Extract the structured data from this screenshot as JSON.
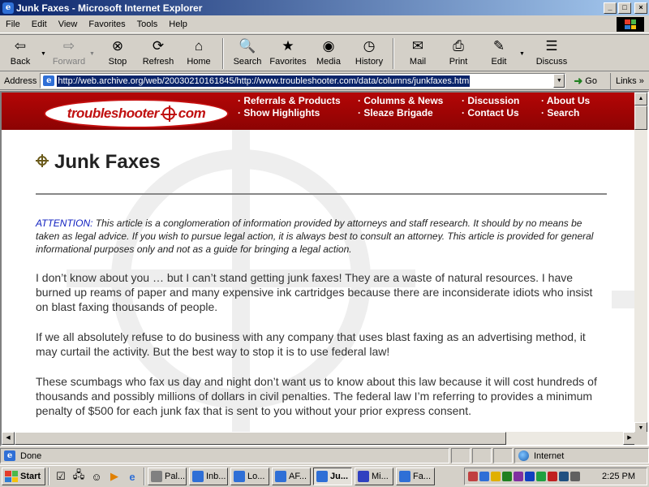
{
  "window": {
    "title": "Junk Faxes - Microsoft Internet Explorer",
    "buttons": {
      "minimize": "_",
      "maximize": "□",
      "close": "×"
    }
  },
  "menu": [
    {
      "label": "File",
      "key": "F"
    },
    {
      "label": "Edit",
      "key": "E"
    },
    {
      "label": "View",
      "key": "V"
    },
    {
      "label": "Favorites",
      "key": "a"
    },
    {
      "label": "Tools",
      "key": "T"
    },
    {
      "label": "Help",
      "key": "H"
    }
  ],
  "toolbar": {
    "back": "Back",
    "forward": "Forward",
    "stop": "Stop",
    "refresh": "Refresh",
    "home": "Home",
    "search": "Search",
    "favorites": "Favorites",
    "media": "Media",
    "history": "History",
    "mail": "Mail",
    "print": "Print",
    "edit": "Edit",
    "discuss": "Discuss"
  },
  "address": {
    "label": "Address",
    "url": "http://web.archive.org/web/20030210161845/http://www.troubleshooter.com/data/columns/junkfaxes.htm",
    "go": "Go",
    "links": "Links",
    "links_chevron": "»"
  },
  "site": {
    "logo_left": "troubleshooter",
    "logo_right": "com",
    "nav": [
      "Referrals & Products",
      "Columns & News",
      "Discussion",
      "About Us",
      "Show Highlights",
      "Sleaze Brigade",
      "Contact Us",
      "Search"
    ]
  },
  "article": {
    "title": "Junk Faxes",
    "attention_label": "ATTENTION:",
    "attention_text": " This article is a conglomeration of information provided by attorneys and staff research. It should by no means be taken as legal advice. If you wish to pursue legal action, it is always best to consult an attorney. This article is provided for general informational purposes only and not as a guide for bringing a legal action.",
    "paragraphs": [
      "I don’t know about you … but I can’t stand getting junk faxes! They are a waste of natural resources. I have burned up reams of paper and many expensive ink cartridges because there are inconsiderate idiots who insist on blast faxing thousands of people.",
      "If we all absolutely refuse to do business with any company that uses blast faxing as an advertising method, it may curtail the activity. But the best way to stop it is to use federal law!",
      "These scumbags who fax us day and night don’t want us to know about this law because it will cost hundreds of thousands and possibly millions of dollars in civil penalties. The federal law I’m referring to provides a minimum penalty of $500 for each junk fax that is sent to you without your prior express consent."
    ]
  },
  "status": {
    "text": "Done",
    "zone": "Internet"
  },
  "taskbar": {
    "start": "Start",
    "tasks": [
      {
        "label": "Pal...",
        "color": "#808080",
        "active": false
      },
      {
        "label": "Inb...",
        "color": "#2f6fd6",
        "active": false
      },
      {
        "label": "Lo...",
        "color": "#2f6fd6",
        "active": false
      },
      {
        "label": "AF...",
        "color": "#2f6fd6",
        "active": false
      },
      {
        "label": "Ju...",
        "color": "#2f6fd6",
        "active": true
      },
      {
        "label": "Mi...",
        "color": "#3040c0",
        "active": false
      },
      {
        "label": "Fa...",
        "color": "#2f6fd6",
        "active": false
      }
    ],
    "clock": "2:25 PM"
  }
}
